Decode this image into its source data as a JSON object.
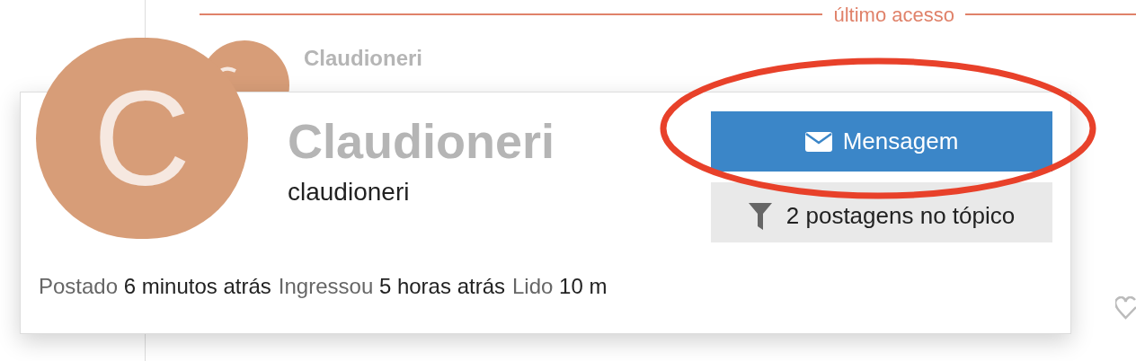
{
  "divider": {
    "label": "último acesso"
  },
  "post": {
    "author": "Claudioneri"
  },
  "user_card": {
    "avatar_letter": "C",
    "name": "Claudioneri",
    "username": "claudioneri",
    "buttons": [
      {
        "kind": "primary",
        "label": "Mensagem"
      },
      {
        "kind": "filter",
        "label": "2 postagens no tópico"
      }
    ],
    "meta": [
      {
        "label": "Postado",
        "value": "6 minutos atrás"
      },
      {
        "label": "Ingressou",
        "value": "5 horas atrás"
      },
      {
        "label": "Lido",
        "value": "10 m"
      }
    ]
  }
}
